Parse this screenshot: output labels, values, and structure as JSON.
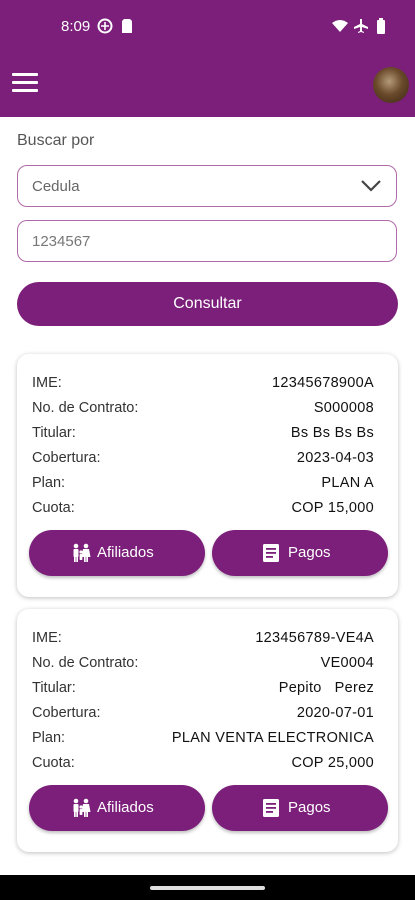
{
  "status_bar": {
    "time": "8:09"
  },
  "search": {
    "label": "Buscar por",
    "type_selected": "Cedula",
    "document_value": "1234567",
    "button_label": "Consultar"
  },
  "card_labels": {
    "ime": "IME:",
    "contract": "No. de Contrato:",
    "holder": "Titular:",
    "coverage": "Cobertura:",
    "plan": "Plan:",
    "fee": "Cuota:"
  },
  "contracts": [
    {
      "ime": "12345678900A",
      "contract": "S000008",
      "holder": "Bs Bs Bs Bs",
      "coverage": "2023-04-03",
      "plan": "PLAN A",
      "fee": "COP 15,000",
      "affiliates_label": "Afiliados",
      "payments_label": "Pagos"
    },
    {
      "ime": "123456789-VE4A",
      "contract": "VE0004",
      "holder": "Pepito   Perez",
      "coverage": "2020-07-01",
      "plan": "PLAN VENTA ELECTRONICA",
      "fee": "COP 25,000",
      "affiliates_label": "Afiliados",
      "payments_label": "Pagos"
    }
  ],
  "colors": {
    "primary": "#7b1f7a",
    "border": "#b06aa8"
  },
  "icons": {
    "menu": "menu-icon",
    "chevron": "chevron-down-icon",
    "affiliates": "family-icon",
    "payments": "receipt-icon"
  }
}
